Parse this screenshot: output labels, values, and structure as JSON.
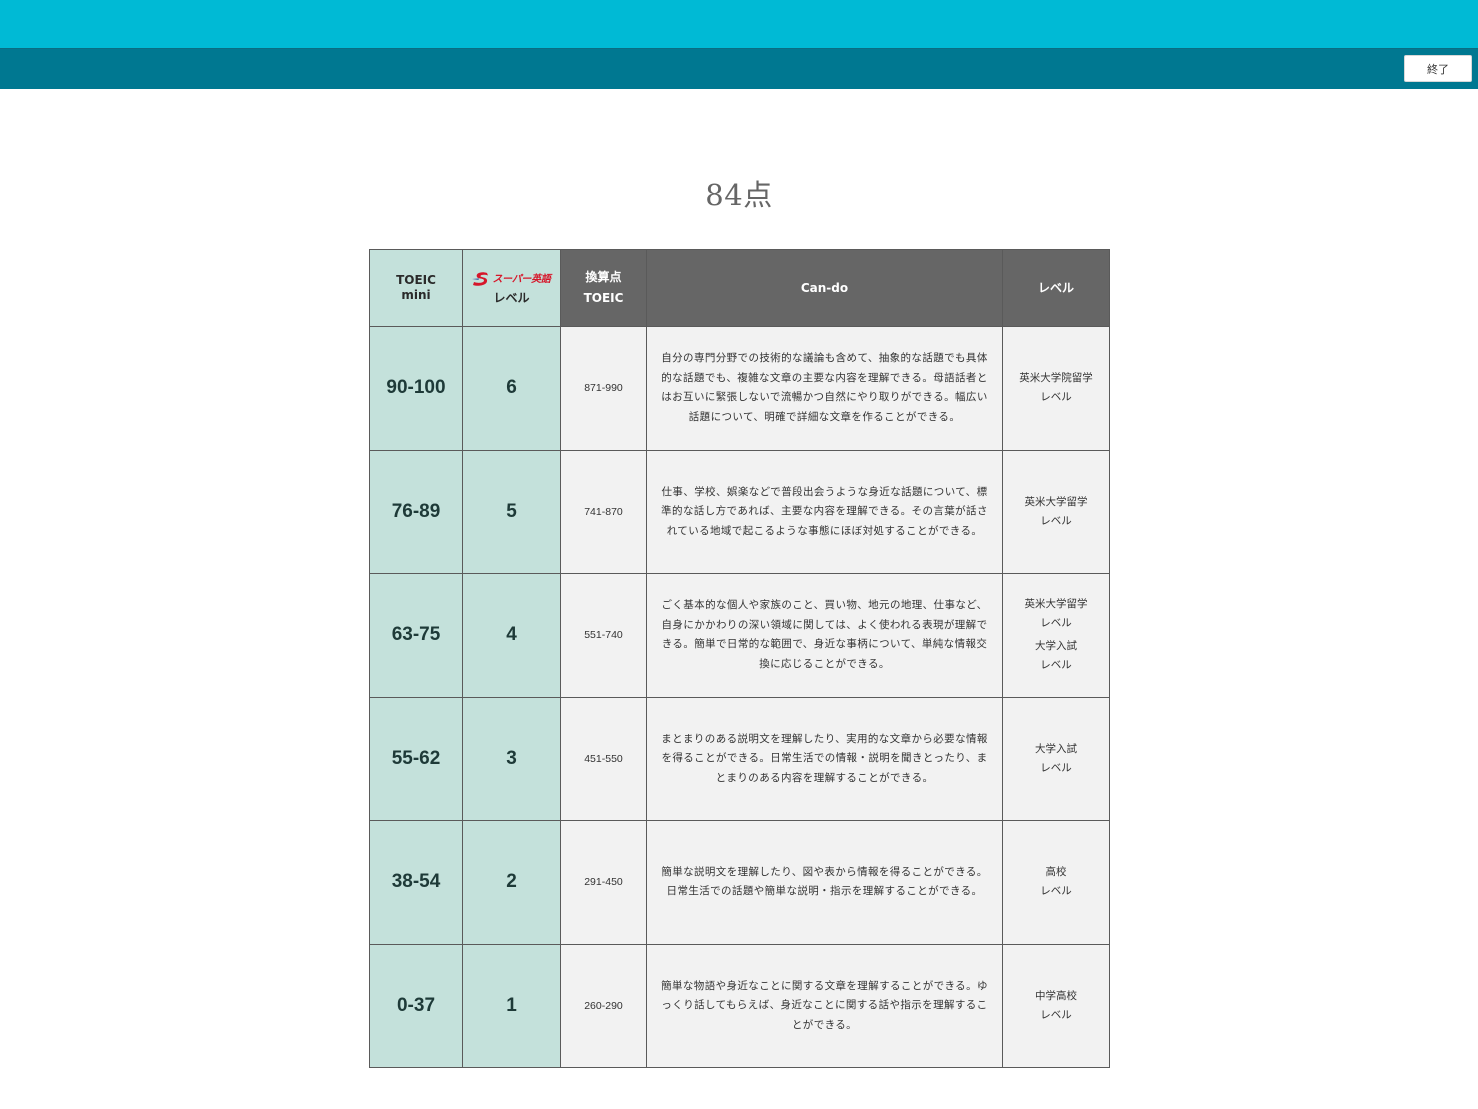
{
  "header": {
    "quit_label": "終了"
  },
  "score": "84点",
  "table": {
    "headers": {
      "toeic_mini_line1": "TOEIC",
      "toeic_mini_line2": "mini",
      "super_logo_text": "スーパー英語",
      "super_level": "レベル",
      "converted_line1": "換算点",
      "converted_line2": "TOEIC",
      "cando": "Can-do",
      "level": "レベル"
    },
    "rows": [
      {
        "mini": "90-100",
        "super": "6",
        "toeic": "871-990",
        "cando": "自分の専門分野での技術的な議論も含めて、抽象的な話題でも具体的な話題でも、複雑な文章の主要な内容を理解できる。母語話者とはお互いに緊張しないで流暢かつ自然にやり取りができる。幅広い話題について、明確で詳細な文章を作ることができる。",
        "level1": "英米大学院留学",
        "level1_sub": "レベル"
      },
      {
        "mini": "76-89",
        "super": "5",
        "toeic": "741-870",
        "cando": "仕事、学校、娯楽などで普段出会うような身近な話題について、標準的な話し方であれば、主要な内容を理解できる。その言葉が話されている地域で起こるような事態にほぼ対処することができる。",
        "level1": "英米大学留学",
        "level1_sub": "レベル"
      },
      {
        "mini": "63-75",
        "super": "4",
        "toeic": "551-740",
        "cando": "ごく基本的な個人や家族のこと、買い物、地元の地理、仕事など、自身にかかわりの深い領域に関しては、よく使われる表現が理解できる。簡単で日常的な範囲で、身近な事柄について、単純な情報交換に応じることができる。",
        "level1": "英米大学留学",
        "level1_sub": "レベル",
        "level2": "大学入試",
        "level2_sub": "レベル"
      },
      {
        "mini": "55-62",
        "super": "3",
        "toeic": "451-550",
        "cando": "まとまりのある説明文を理解したり、実用的な文章から必要な情報を得ることができる。日常生活での情報・説明を聞きとったり、まとまりのある内容を理解することができる。",
        "level1": "大学入試",
        "level1_sub": "レベル"
      },
      {
        "mini": "38-54",
        "super": "2",
        "toeic": "291-450",
        "cando": "簡単な説明文を理解したり、図や表から情報を得ることができる。日常生活での話題や簡単な説明・指示を理解することができる。",
        "level1": "高校",
        "level1_sub": "レベル"
      },
      {
        "mini": "0-37",
        "super": "1",
        "toeic": "260-290",
        "cando": "簡単な物語や身近なことに関する文章を理解することができる。ゆっくり話してもらえば、身近なことに関する話や指示を理解することができる。",
        "level1": "中学高校",
        "level1_sub": "レベル"
      }
    ]
  },
  "colors": {
    "topbar": "#00bad5",
    "subbar": "#007891",
    "teal_cell": "#c4e1db",
    "dark_header": "#666666",
    "logo_red": "#d6162a"
  },
  "icons": {
    "logo": "super-eigo-s-logo-icon"
  }
}
